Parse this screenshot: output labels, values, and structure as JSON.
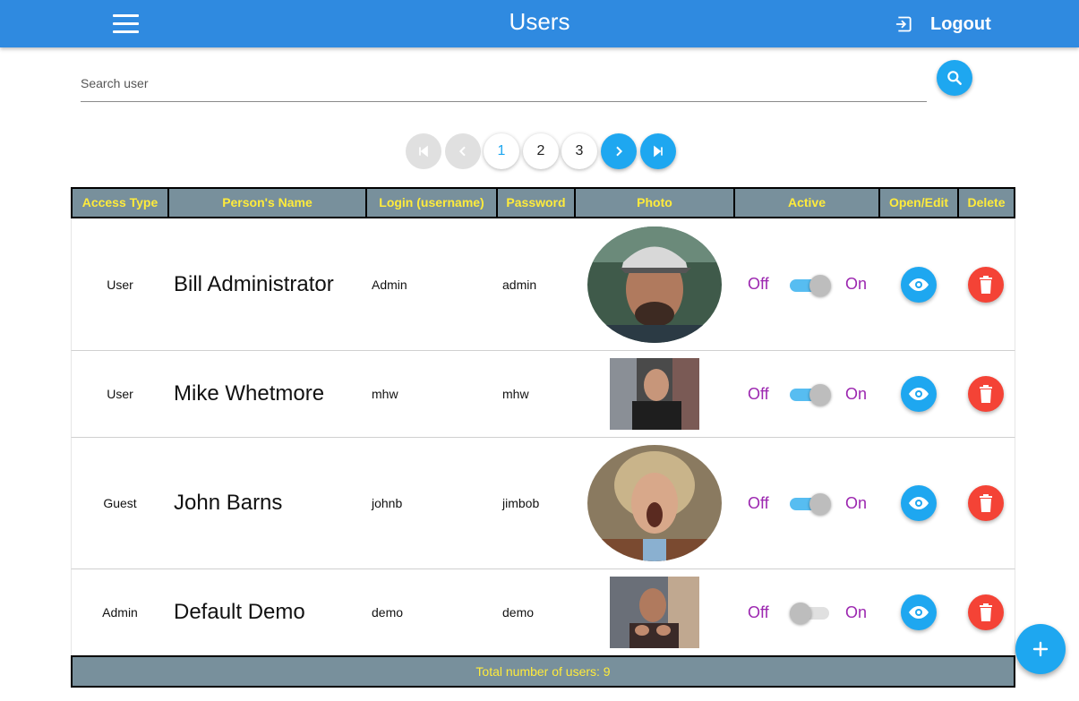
{
  "header": {
    "title": "Users",
    "logout_label": "Logout",
    "menu_icon": "hamburger-menu-icon",
    "logout_icon": "exit-icon",
    "color": "#2f8ae0"
  },
  "search": {
    "placeholder": "Search user",
    "value": "",
    "button_icon": "magnifier-icon"
  },
  "pagination": {
    "pages": [
      "1",
      "2",
      "3"
    ],
    "current": "1",
    "first_icon": "first-page-icon",
    "prev_icon": "chevron-left-icon",
    "next_icon": "chevron-right-icon",
    "last_icon": "last-page-icon"
  },
  "table": {
    "columns": [
      "Access Type",
      "Person's Name",
      "Login (username)",
      "Password",
      "Photo",
      "Active",
      "Open/Edit",
      "Delete"
    ],
    "toggle_off_label": "Off",
    "toggle_on_label": "On",
    "rows": [
      {
        "access": "User",
        "name": "Bill Administrator",
        "login": "Admin",
        "password": "admin",
        "photo_shape": "oval",
        "active": true
      },
      {
        "access": "User",
        "name": "Mike Whetmore",
        "login": "mhw",
        "password": "mhw",
        "photo_shape": "rectangle",
        "active": true
      },
      {
        "access": "Guest",
        "name": "John Barns",
        "login": "johnb",
        "password": "jimbob",
        "photo_shape": "oval",
        "active": true
      },
      {
        "access": "Admin",
        "name": "Default Demo",
        "login": "demo",
        "password": "demo",
        "photo_shape": "rectangle",
        "active": false
      }
    ],
    "footer": "Total number of users: 9",
    "header_bg": "#78909c",
    "header_text_color": "#ffeb3b"
  },
  "colors": {
    "accent_blue": "#1ea7f0",
    "delete_red": "#f44336",
    "toggle_label": "#9c27b0"
  },
  "fab": {
    "icon": "plus-icon"
  }
}
